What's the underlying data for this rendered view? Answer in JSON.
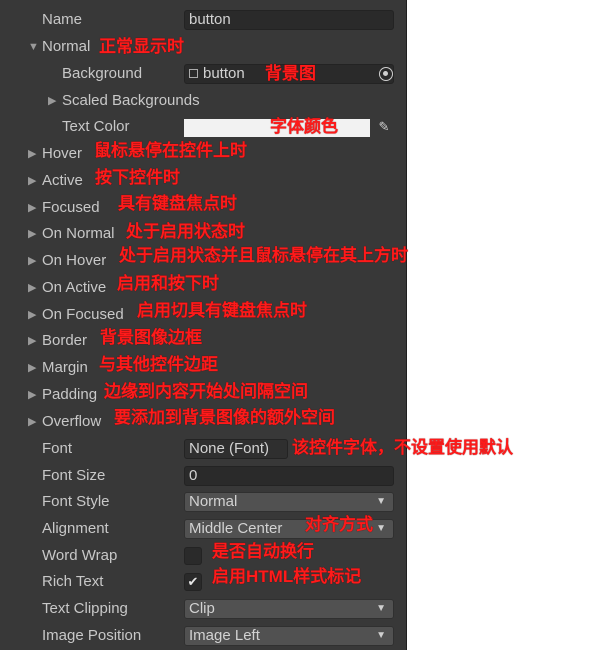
{
  "rows": {
    "name": {
      "label": "Name",
      "value": "button"
    },
    "normal": {
      "label": "Normal",
      "anno": "正常显示时"
    },
    "background": {
      "label": "Background",
      "value": "button",
      "anno": "背景图"
    },
    "scaled": {
      "label": "Scaled Backgrounds"
    },
    "text_color": {
      "label": "Text Color",
      "anno": "字体颜色",
      "color": "#f2f2f2"
    },
    "hover": {
      "label": "Hover",
      "anno": "鼠标悬停在控件上时"
    },
    "active": {
      "label": "Active",
      "anno": "按下控件时"
    },
    "focused": {
      "label": "Focused",
      "anno": "具有键盘焦点时"
    },
    "on_normal": {
      "label": "On Normal",
      "anno": "处于启用状态时"
    },
    "on_hover": {
      "label": "On Hover",
      "anno": "处于启用状态并且鼠标悬停在其上方时"
    },
    "on_active": {
      "label": "On Active",
      "anno": "启用和按下时"
    },
    "on_focused": {
      "label": "On Focused",
      "anno": "启用切具有键盘焦点时"
    },
    "border": {
      "label": "Border",
      "anno": "背景图像边框"
    },
    "margin": {
      "label": "Margin",
      "anno": "与其他控件边距"
    },
    "padding": {
      "label": "Padding",
      "anno": "边缘到内容开始处间隔空间"
    },
    "overflow": {
      "label": "Overflow",
      "anno": "要添加到背景图像的额外空间"
    },
    "font": {
      "label": "Font",
      "value": "None (Font)",
      "anno": "该控件字体，不设置使用默认"
    },
    "font_size": {
      "label": "Font Size",
      "value": "0"
    },
    "font_style": {
      "label": "Font Style",
      "value": "Normal"
    },
    "alignment": {
      "label": "Alignment",
      "value": "Middle Center",
      "anno": "对齐方式"
    },
    "word_wrap": {
      "label": "Word Wrap",
      "anno": "是否自动换行"
    },
    "rich_text": {
      "label": "Rich Text",
      "check": "✔",
      "anno": "启用HTML样式标记"
    },
    "text_clipping": {
      "label": "Text Clipping",
      "value": "Clip"
    },
    "image_position": {
      "label": "Image Position",
      "value": "Image Left"
    }
  },
  "icons": {
    "foldout_closed": "▶",
    "foldout_open": "▼",
    "dropdown": "▼",
    "eyedropper": "✎"
  },
  "colors": {
    "panel": "#383838",
    "annotation": "#ff1a1a",
    "text": "#c8c8c8"
  }
}
